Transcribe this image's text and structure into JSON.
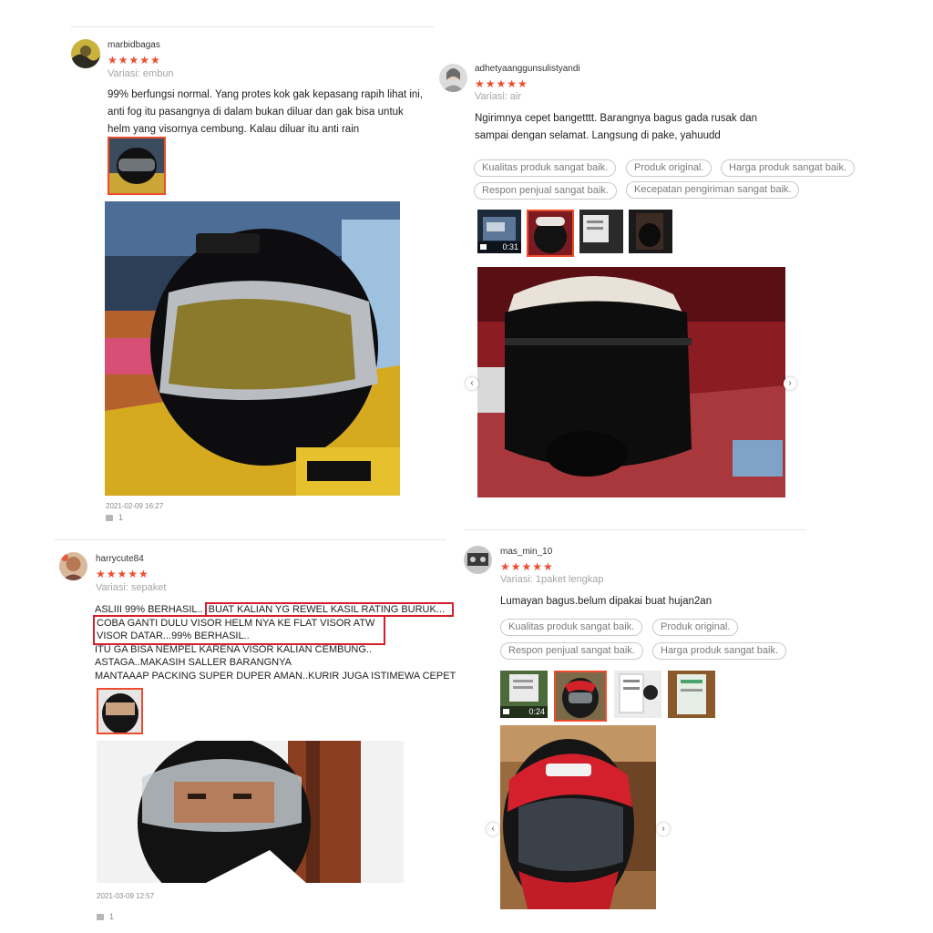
{
  "reviews": [
    {
      "username": "marbidbagas",
      "rating_stars": "★★★★★",
      "variant": "Variasi: embun",
      "text_lines": [
        "99% berfungsi normal. Yang protes kok gak kepasang rapih lihat ini,",
        "anti fog itu pasangnya di dalam bukan diluar dan gak bisa untuk",
        "helm yang visornya cembung. Kalau diluar itu anti rain"
      ],
      "datetime": "2021-02-09 16:27",
      "likes": "1"
    },
    {
      "username": "adhetyaanggunsulistyandi",
      "rating_stars": "★★★★★",
      "variant": "Variasi: air",
      "text_lines": [
        "Ngirimnya cepet bangetttt. Barangnya bagus gada rusak dan",
        "sampai dengan selamat.  Langsung di pake, yahuudd"
      ],
      "tags": [
        "Kualitas produk sangat baik.",
        "Produk original.",
        "Harga produk sangat baik.",
        "Respon penjual sangat baik.",
        "Kecepatan pengiriman sangat baik."
      ],
      "video_duration": "0:31"
    },
    {
      "username": "harrycute84",
      "rating_stars": "★★★★★",
      "variant": "Variasi: sepaket",
      "text_line1_a": "ASLIII 99% BERHASIL..",
      "text_line1_b": "BUAT KALIAN YG REWEL KASIL RATING BURUK...",
      "text_line2": "COBA GANTI DULU VISOR HELM NYA KE FLAT VISOR ATW",
      "text_line3": "VISOR DATAR...99% BERHASIL..",
      "text_line4": "ITU GA BISA NEMPEL KARENA VISOR KALIAN CEMBUNG..",
      "text_line5": "ASTAGA..MAKASIH SALLER BARANGNYA",
      "text_line6": "MANTAAAP PACKING SUPER DUPER AMAN..KURIR JUGA ISTIMEWA CEPET",
      "datetime": "2021-03-09 12:57",
      "likes": "1"
    },
    {
      "username": "mas_min_10",
      "rating_stars": "★★★★★",
      "variant": "Variasi: 1paket lengkap",
      "text_lines": [
        "Lumayan bagus.belum dipakai buat hujan2an"
      ],
      "tags": [
        "Kualitas produk sangat baik.",
        "Produk original.",
        "Respon penjual sangat baik.",
        "Harga produk sangat baik."
      ],
      "video_duration": "0:24"
    }
  ],
  "icons": {
    "star": "star-icon",
    "like": "thumbs-up-icon",
    "prev": "chevron-left-icon",
    "next": "chevron-right-icon",
    "video": "video-camera-icon"
  },
  "colors": {
    "accent": "#ee4d2d",
    "highlight_box": "#d4202c",
    "muted_text": "#a5a5a5",
    "tag_border": "#c9c9c9"
  }
}
